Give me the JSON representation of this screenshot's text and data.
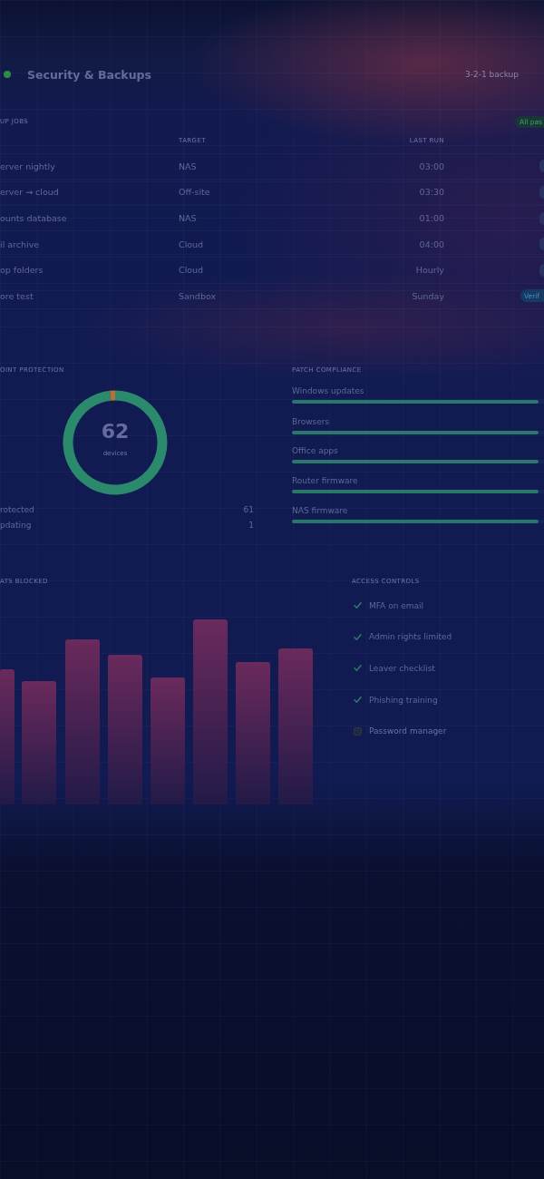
{
  "header": {
    "title": "Security & Backups",
    "status": "3-2-1 backup"
  },
  "backup_jobs": {
    "label": "UP JOBS",
    "badge": "All pas",
    "columns": [
      "TARGET",
      "LAST RUN"
    ],
    "rows": [
      {
        "job": "erver nightly",
        "target": "NAS",
        "last_run": "03:00",
        "status": {
          "kind": "ok"
        }
      },
      {
        "job": "erver → cloud",
        "target": "Off-site",
        "last_run": "03:30",
        "status": {
          "kind": "ok"
        }
      },
      {
        "job": "ounts database",
        "target": "NAS",
        "last_run": "01:00",
        "status": {
          "kind": "ok"
        }
      },
      {
        "job": "il archive",
        "target": "Cloud",
        "last_run": "04:00",
        "status": {
          "kind": "ok"
        }
      },
      {
        "job": "op folders",
        "target": "Cloud",
        "last_run": "Hourly",
        "status": {
          "kind": "ok"
        }
      },
      {
        "job": "ore test",
        "target": "Sandbox",
        "last_run": "Sunday",
        "status": {
          "kind": "pending",
          "label": "Verif"
        }
      }
    ]
  },
  "endpoint_protection": {
    "label": "OINT PROTECTION",
    "total": "62",
    "unit": "devices",
    "chart_data": {
      "type": "donut",
      "values": [
        98.39,
        1.61
      ]
    },
    "legend": [
      {
        "label": "rotected",
        "value": "61",
        "color": "#2b8a6c"
      },
      {
        "label": "pdating",
        "value": "1",
        "color": "#b8703a"
      }
    ]
  },
  "patch_compliance": {
    "label": "PATCH COMPLIANCE",
    "items": [
      {
        "name": "Windows updates",
        "level": 0.98
      },
      {
        "name": "Browsers",
        "level": 0.98
      },
      {
        "name": "Office apps",
        "level": 0.98
      },
      {
        "name": "Router firmware",
        "level": 0.98
      },
      {
        "name": "NAS firmware",
        "level": 0.98
      }
    ]
  },
  "threats_blocked": {
    "label": "ATS BLOCKED"
  },
  "access_controls": {
    "label": "ACCESS CONTROLS",
    "items": [
      {
        "label": "MFA on email",
        "checked": true
      },
      {
        "label": "Admin rights limited",
        "checked": true
      },
      {
        "label": "Leaver checklist",
        "checked": true
      },
      {
        "label": "Phishing training",
        "checked": true
      },
      {
        "label": "Password manager",
        "checked": false
      }
    ]
  }
}
